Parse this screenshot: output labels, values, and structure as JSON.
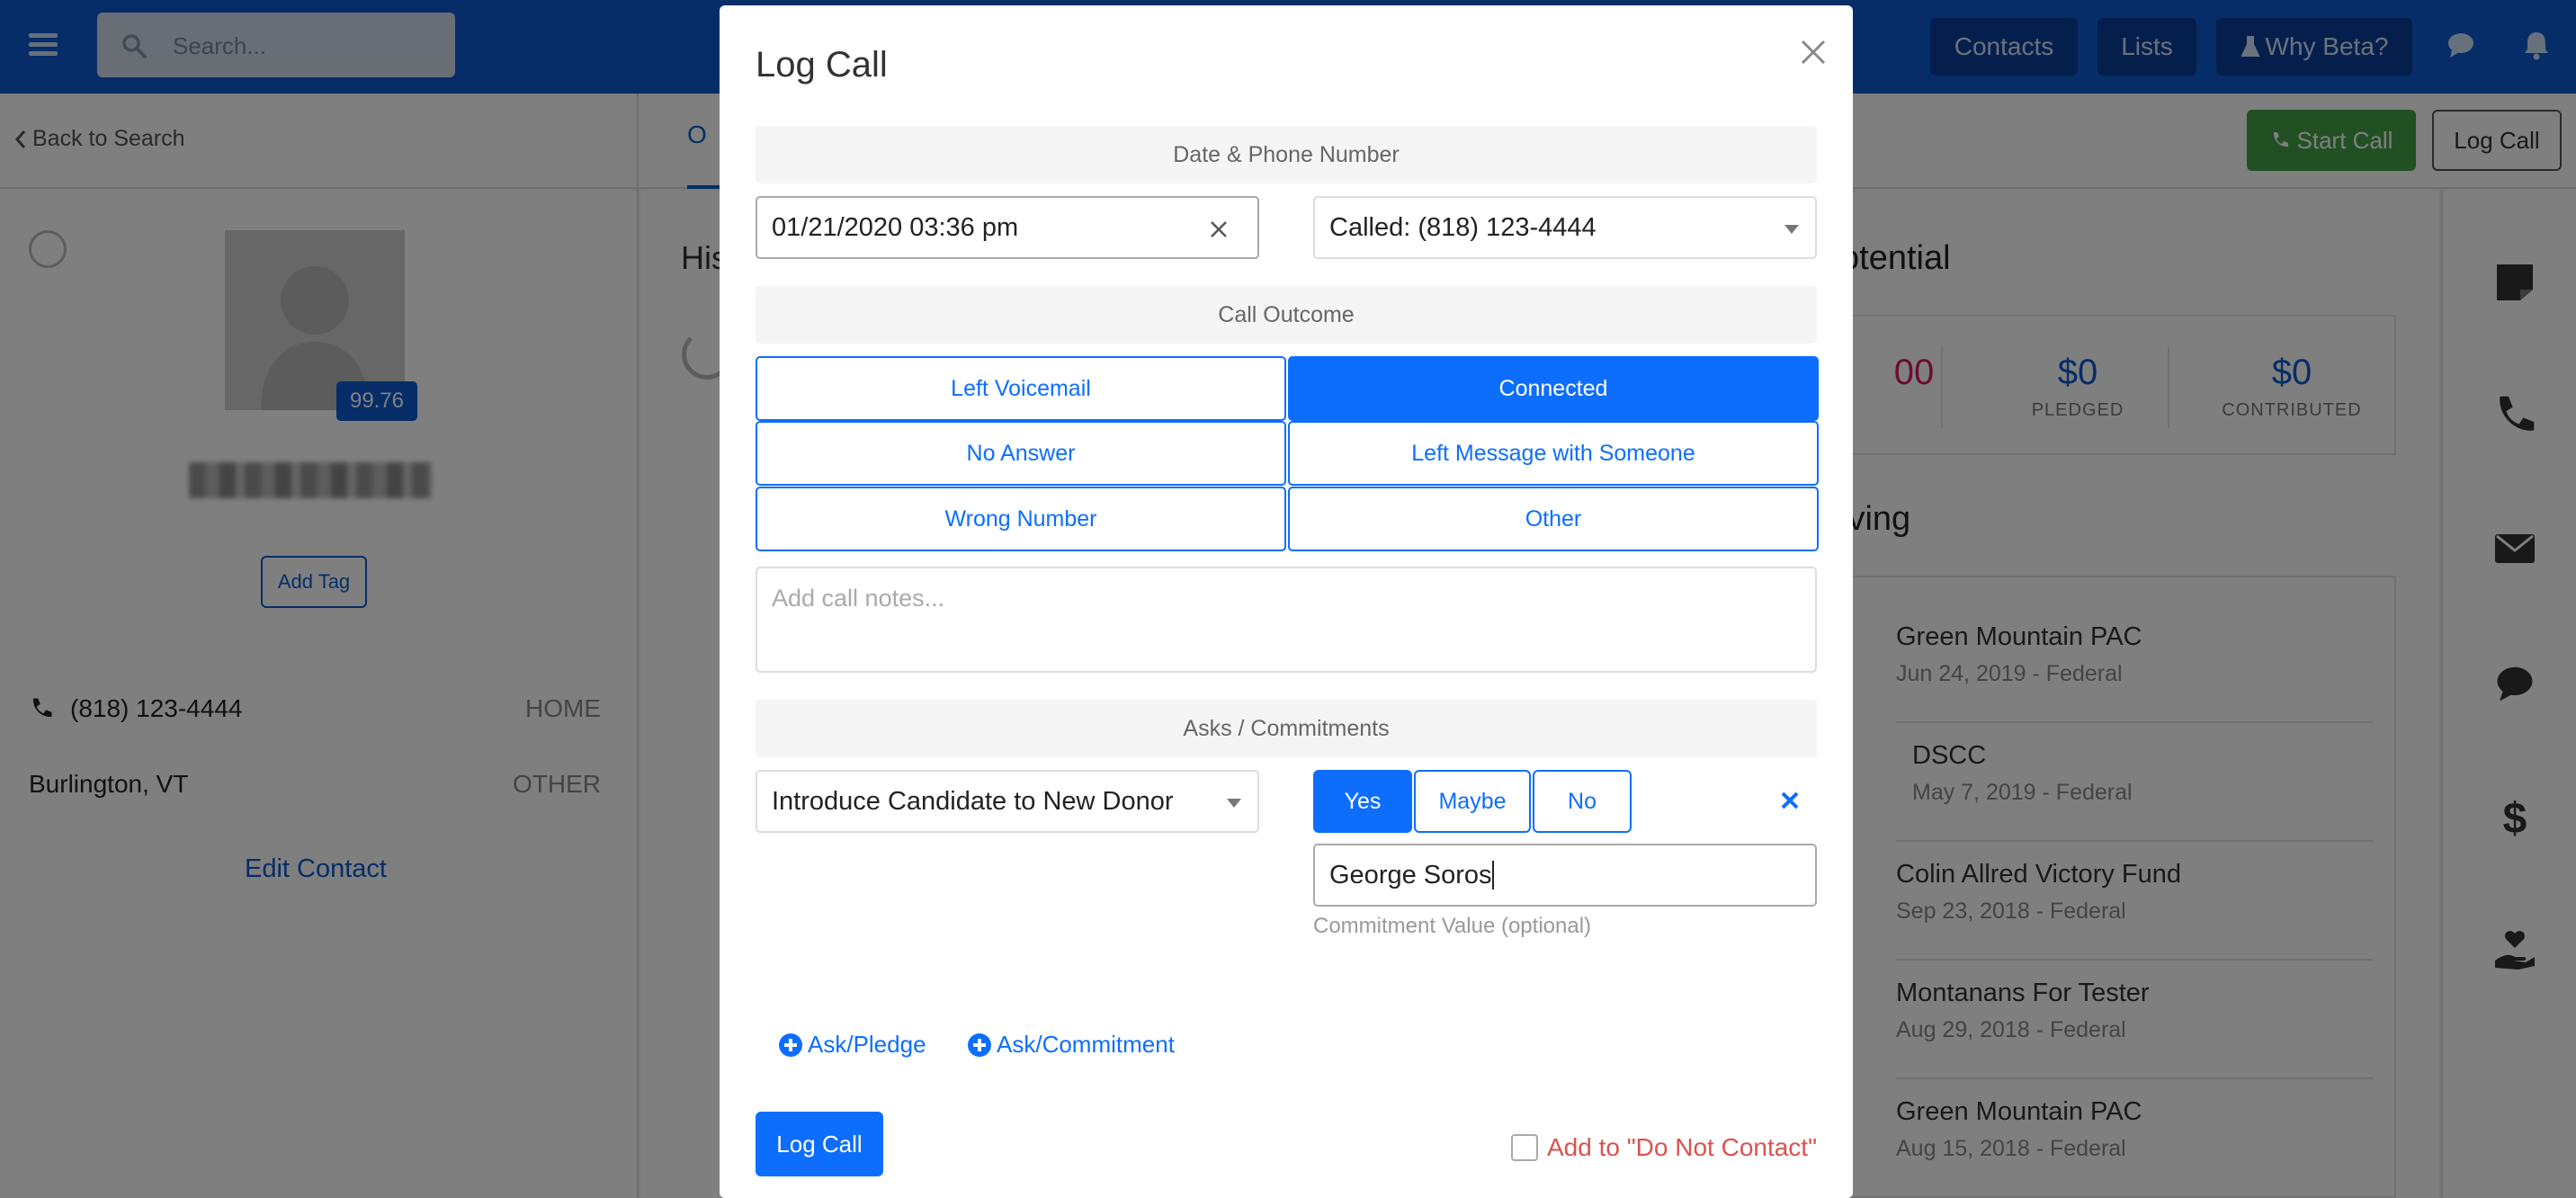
{
  "topbar": {
    "search_placeholder": "Search...",
    "nav": [
      "Contacts",
      "Lists",
      "Why Beta?"
    ]
  },
  "subheader": {
    "back_label": "Back to Search",
    "active_tab": "O",
    "start_call_label": "Start Call",
    "log_call_label": "Log Call"
  },
  "contact": {
    "score": "99.76",
    "add_tag_label": "Add Tag",
    "phone": "(818) 123-4444",
    "phone_type": "HOME",
    "location": "Burlington, VT",
    "location_type": "OTHER",
    "edit_label": "Edit Contact"
  },
  "middle": {
    "heading": "His"
  },
  "right": {
    "potential_heading": "otential",
    "potential": [
      {
        "value": "00",
        "label": ""
      },
      {
        "value": "$0",
        "label": "PLEDGED"
      },
      {
        "value": "$0",
        "label": "CONTRIBUTED"
      }
    ],
    "giving_heading": "iving",
    "giving": [
      {
        "name": "Green Mountain PAC",
        "date": "Jun 24, 2019 - Federal"
      },
      {
        "name": "DSCC",
        "date": "May 7, 2019 - Federal"
      },
      {
        "name": "Colin Allred Victory Fund",
        "date": "Sep 23, 2018 - Federal"
      },
      {
        "name": "Montanans For Tester",
        "date": "Aug 29, 2018 - Federal"
      },
      {
        "name": "Green Mountain PAC",
        "date": "Aug 15, 2018 - Federal"
      }
    ]
  },
  "modal": {
    "title": "Log Call",
    "section_date_phone": "Date & Phone Number",
    "datetime_value": "01/21/2020 03:36 pm",
    "called_value": "Called: (818) 123-4444",
    "section_outcome": "Call Outcome",
    "outcomes": [
      "Left Voicemail",
      "Connected",
      "No Answer",
      "Left Message with Someone",
      "Wrong Number",
      "Other"
    ],
    "selected_outcome": "Connected",
    "notes_placeholder": "Add call notes...",
    "section_asks": "Asks / Commitments",
    "ask_type_value": "Introduce Candidate to New Donor",
    "answers": [
      "Yes",
      "Maybe",
      "No"
    ],
    "selected_answer": "Yes",
    "commitment_value": "George Soros",
    "commitment_help": "Commitment Value (optional)",
    "add_pledge_label": "Ask/Pledge",
    "add_commitment_label": "Ask/Commitment",
    "submit_label": "Log Call",
    "dnc_label": "Add to \"Do Not Contact\""
  },
  "colors": {
    "brand_blue": "#0d5bd1",
    "button_blue": "#0d6efd",
    "start_call_green": "#43a047",
    "danger_red": "#d9534f"
  }
}
